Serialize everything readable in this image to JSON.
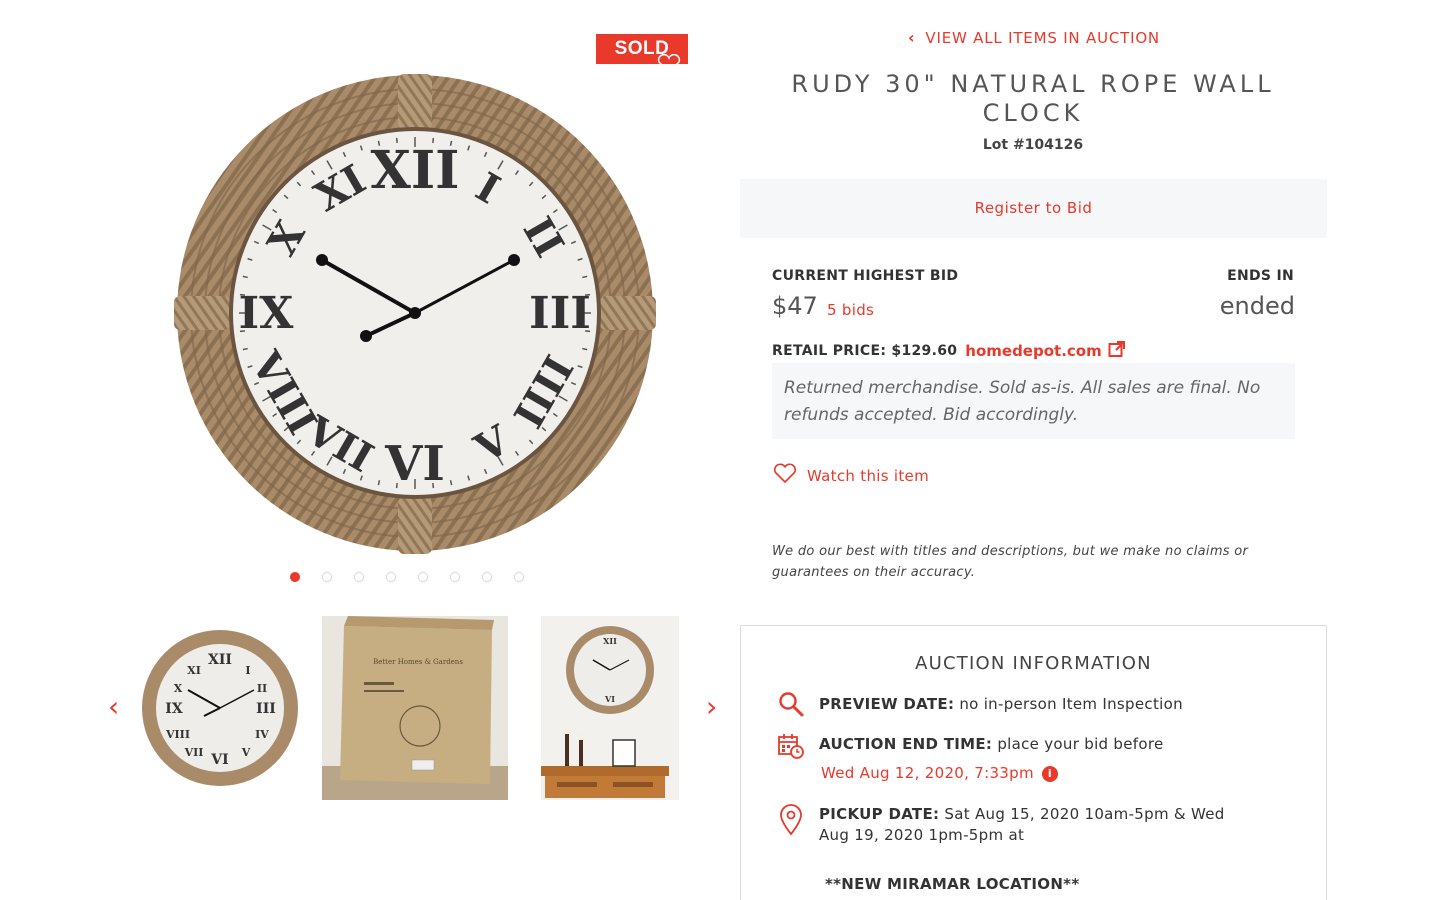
{
  "gallery": {
    "sold_badge": "SOLD",
    "dot_count": 8,
    "active_dot": 1,
    "prev_arrow": "‹",
    "next_arrow": "›",
    "thumb_box_text": "Better Homes & Gardens"
  },
  "nav": {
    "back_icon": "chevron-left-icon",
    "back_label": "VIEW ALL ITEMS IN AUCTION"
  },
  "item": {
    "title": "RUDY 30\" NATURAL ROPE WALL CLOCK",
    "lot": "Lot #104126"
  },
  "bidding": {
    "register_label": "Register to Bid",
    "current_label": "CURRENT HIGHEST BID",
    "amount": "$47",
    "bid_count": "5 bids",
    "ends_label": "ENDS IN",
    "ends_value": "ended",
    "retail_label": "RETAIL PRICE: $129.60",
    "retail_source": "homedepot.com",
    "disclaimer": "Returned merchandise.   Sold as-is. All sales are final. No refunds accepted. Bid accordingly.",
    "watch_label": "Watch this item",
    "accuracy_note": "We do our best with titles and descriptions, but we make no claims or guarantees on their accuracy."
  },
  "auction_info": {
    "title": "AUCTION INFORMATION",
    "preview_label": "PREVIEW DATE:",
    "preview_value": "no in-person Item Inspection",
    "end_label": "AUCTION END TIME:",
    "end_value": "place your bid before",
    "end_date": "Wed Aug 12, 2020, 7:33pm",
    "pickup_label": "PICKUP DATE:",
    "pickup_value": "Sat Aug 15, 2020 10am-5pm & Wed",
    "pickup_value_2": "Aug 19, 2020 1pm-5pm at",
    "new_location": "**NEW MIRAMAR LOCATION**"
  },
  "colors": {
    "accent": "#e8392b",
    "panel_bg": "#f6f7f8"
  }
}
